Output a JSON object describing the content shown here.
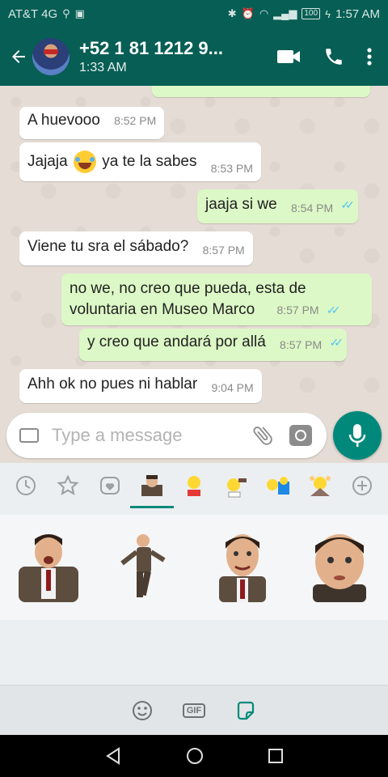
{
  "status_bar": {
    "carrier": "AT&T 4G",
    "battery": "100",
    "time": "1:57 AM"
  },
  "header": {
    "contact_name": "+52 1 81 1212 9...",
    "contact_status": "1:33 AM"
  },
  "messages": [
    {
      "direction": "in",
      "text": "A huevooo",
      "time": "8:52 PM"
    },
    {
      "direction": "in",
      "text_before": "Jajaja",
      "emoji": "joy-emoji",
      "text_after": "ya te la sabes",
      "time": "8:53 PM"
    },
    {
      "direction": "out",
      "text": "jaaja si we",
      "time": "8:54 PM",
      "status": "read"
    },
    {
      "direction": "in",
      "text": "Viene tu sra el sábado?",
      "time": "8:57 PM"
    },
    {
      "direction": "out",
      "lines": [
        "no we, no creo que pueda, esta de",
        "voluntaria en Museo Marco"
      ],
      "time": "8:57 PM",
      "status": "read"
    },
    {
      "direction": "out",
      "text": "y creo que andará por allá",
      "time": "8:57 PM",
      "status": "read"
    },
    {
      "direction": "in",
      "text": "Ahh ok no pues ni hablar",
      "time": "9:04 PM"
    }
  ],
  "input": {
    "placeholder": "Type a message"
  },
  "sticker_tabs": [
    "recent-icon",
    "star-icon",
    "heart-icon",
    "pack-mr-bean",
    "pack-simpsons-1",
    "pack-simpsons-2",
    "pack-simpsons-3",
    "pack-simpsons-4",
    "add-icon"
  ],
  "bottom_bar": {
    "gif_label": "GIF"
  },
  "colors": {
    "header": "#075e54",
    "accent": "#00897b",
    "outgoing_bubble": "#dcf8c6",
    "incoming_bubble": "#ffffff",
    "read_ticks": "#4fc3f7"
  }
}
